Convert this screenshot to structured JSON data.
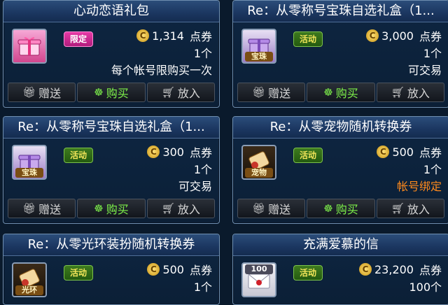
{
  "currency_icon": "coupon-coin-icon",
  "buttons": {
    "gift": "赠送",
    "buy": "购买",
    "cart": "放入"
  },
  "items": [
    {
      "title": "心动恋语礼包",
      "badge": "限定",
      "badge_type": "limited",
      "price": "1,314",
      "unit": "点券",
      "qty": "1个",
      "note": "每个帐号限购买一次",
      "note_color": "#ffffff",
      "icon": "pink-gift-box-icon",
      "icon_tag": ""
    },
    {
      "title": "Re：从零称号宝珠自选礼盒（1...",
      "badge": "活动",
      "badge_type": "event",
      "price": "3,000",
      "unit": "点券",
      "qty": "1个",
      "note": "可交易",
      "note_color": "#ffffff",
      "icon": "purple-gift-box-icon",
      "icon_tag": "宝珠"
    },
    {
      "title": "Re：从零称号宝珠自选礼盒（1...",
      "badge": "活动",
      "badge_type": "event",
      "price": "300",
      "unit": "点券",
      "qty": "1个",
      "note": "可交易",
      "note_color": "#ffffff",
      "icon": "purple-gift-box-icon",
      "icon_tag": "宝珠"
    },
    {
      "title": "Re：从零宠物随机转换券",
      "badge": "活动",
      "badge_type": "event",
      "price": "500",
      "unit": "点券",
      "qty": "1个",
      "note": "帐号绑定",
      "note_color": "#ff8a1c",
      "icon": "scroll-ticket-icon",
      "icon_tag": "宠物"
    },
    {
      "title": "Re：从零光环装扮随机转换券",
      "badge": "活动",
      "badge_type": "event",
      "price": "500",
      "unit": "点券",
      "qty": "1个",
      "note": "",
      "note_color": "#ffffff",
      "icon": "scroll-ticket-icon",
      "icon_tag": "光环"
    },
    {
      "title": "充满爱慕的信",
      "badge": "活动",
      "badge_type": "event",
      "price": "23,200",
      "unit": "点券",
      "qty": "100个",
      "note": "",
      "note_color": "#ffffff",
      "icon": "love-letter-icon",
      "icon_tag": "100"
    }
  ]
}
